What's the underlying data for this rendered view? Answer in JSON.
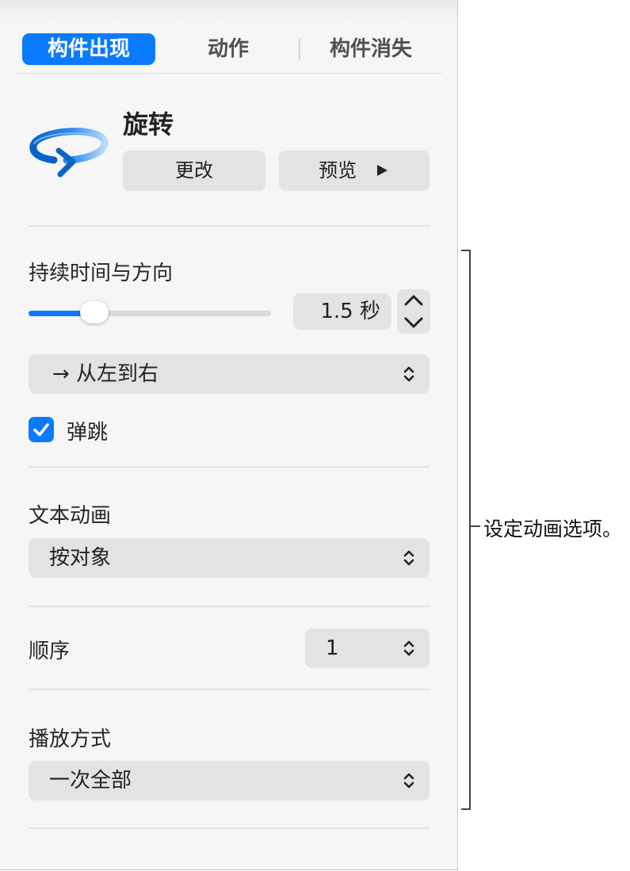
{
  "tabs": [
    {
      "label": "构件出现",
      "active": true
    },
    {
      "label": "动作",
      "active": false
    },
    {
      "label": "构件消失",
      "active": false
    }
  ],
  "animation": {
    "name": "旋转",
    "icon": "rotate-arrow-icon",
    "change_label": "更改",
    "preview_label": "预览"
  },
  "duration": {
    "section_label": "持续时间与方向",
    "value_text": "1.5 秒",
    "slider_level": 0.27
  },
  "direction": {
    "value": "→ 从左到右"
  },
  "bounce": {
    "label": "弹跳",
    "checked": true
  },
  "text_animation": {
    "section_label": "文本动画",
    "value": "按对象"
  },
  "order": {
    "label": "顺序",
    "value": "1"
  },
  "playback": {
    "section_label": "播放方式",
    "value": "一次全部"
  },
  "callout": {
    "text": "设定动画选项。"
  },
  "colors": {
    "accent": "#0a7bff",
    "control_bg": "#e3e3e3",
    "panel_bg": "#f6f6f6"
  }
}
